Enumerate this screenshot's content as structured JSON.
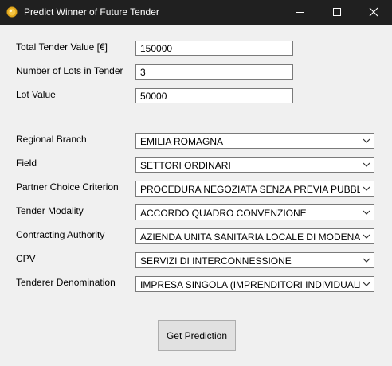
{
  "window": {
    "title": "Predict Winner of Future Tender"
  },
  "inputs": [
    {
      "label": "Total Tender Value [€]",
      "value": "150000"
    },
    {
      "label": "Number of Lots in Tender",
      "value": "3"
    },
    {
      "label": "Lot Value",
      "value": "50000"
    }
  ],
  "dropdowns": [
    {
      "label": "Regional Branch",
      "value": "EMILIA ROMAGNA"
    },
    {
      "label": "Field",
      "value": "SETTORI ORDINARI"
    },
    {
      "label": "Partner Choice Criterion",
      "value": "PROCEDURA NEGOZIATA SENZA PREVIA PUBBLICAZIONE"
    },
    {
      "label": "Tender Modality",
      "value": "ACCORDO QUADRO CONVENZIONE"
    },
    {
      "label": "Contracting Authority",
      "value": "AZIENDA UNITA SANITARIA LOCALE DI MODENA"
    },
    {
      "label": "CPV",
      "value": "SERVIZI DI INTERCONNESSIONE"
    },
    {
      "label": "Tenderer Denomination",
      "value": "IMPRESA SINGOLA (IMPRENDITORI INDIVIDUALI, ANCHE ARTIGIANI)"
    }
  ],
  "actions": {
    "predict_label": "Get Prediction"
  },
  "colors": {
    "titlebar": "#202020",
    "window_bg": "#f0f0f0",
    "button_bg": "#e1e1e1",
    "app_icon": "#f5c542"
  }
}
